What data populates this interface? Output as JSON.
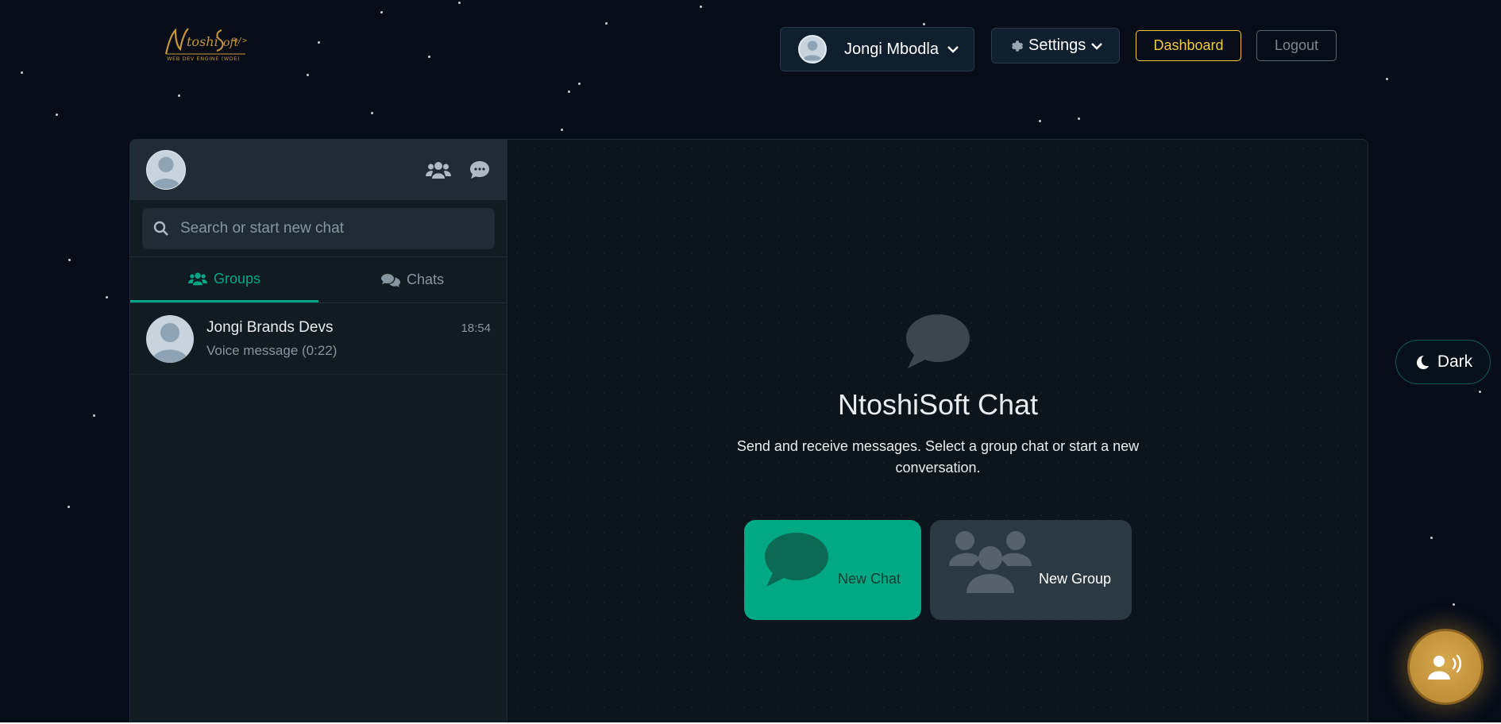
{
  "nav": {
    "logo_alt": "NtoshiSoft WEB DEV ENGINE (WDE)",
    "user_name": "Jongi Mbodla",
    "settings_label": "Settings",
    "dashboard_label": "Dashboard",
    "logout_label": "Logout"
  },
  "sidebar": {
    "search_placeholder": "Search or start new chat",
    "tabs": [
      {
        "label": "Groups",
        "active": true
      },
      {
        "label": "Chats",
        "active": false
      }
    ],
    "chats": [
      {
        "name": "Jongi Brands Devs",
        "time": "18:54",
        "preview": "Voice message (0:22)"
      }
    ]
  },
  "main": {
    "title": "NtoshiSoft Chat",
    "subtitle": "Send and receive messages. Select a group chat or start a new conversation.",
    "new_chat_label": "New Chat",
    "new_group_label": "New Group"
  },
  "theme": {
    "label": "Dark"
  },
  "colors": {
    "accent": "#00a884",
    "gold": "#f5c842",
    "bg": "#060c18"
  }
}
